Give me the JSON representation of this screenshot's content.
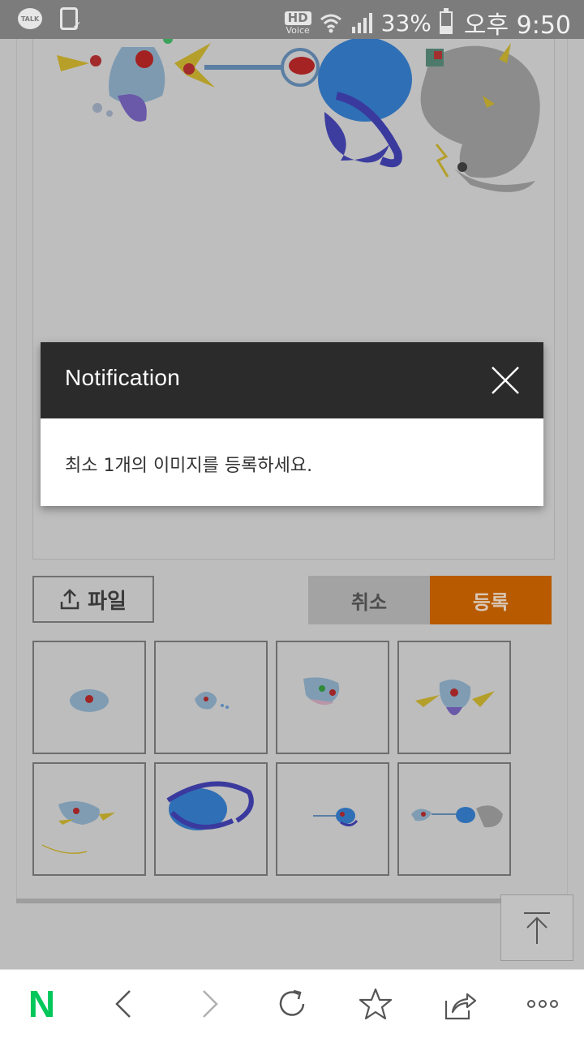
{
  "status_bar": {
    "talk_label": "TALK",
    "hd_label": "HD",
    "voice_label": "Voice",
    "battery_percent": "33%",
    "time": "오후 9:50"
  },
  "notification": {
    "title": "Notification",
    "message": "최소 1개의 이미지를 등록하세요."
  },
  "actions": {
    "file_label": "파일",
    "cancel_label": "취소",
    "register_label": "등록"
  },
  "thumbnails": [
    {
      "name": "thumbnail-1"
    },
    {
      "name": "thumbnail-2"
    },
    {
      "name": "thumbnail-3"
    },
    {
      "name": "thumbnail-4"
    },
    {
      "name": "thumbnail-5"
    },
    {
      "name": "thumbnail-6"
    },
    {
      "name": "thumbnail-7"
    },
    {
      "name": "thumbnail-8"
    }
  ],
  "toolbar": {
    "home_icon": "naver-n-icon",
    "home_label": "N",
    "back_icon": "chevron-left-icon",
    "forward_icon": "chevron-right-icon",
    "refresh_icon": "refresh-icon",
    "bookmark_icon": "star-icon",
    "share_icon": "share-icon",
    "more_icon": "more-icon"
  },
  "colors": {
    "accent": "#b85a00",
    "modal_header": "#2b2b2b",
    "naver_green": "#03c75a"
  }
}
